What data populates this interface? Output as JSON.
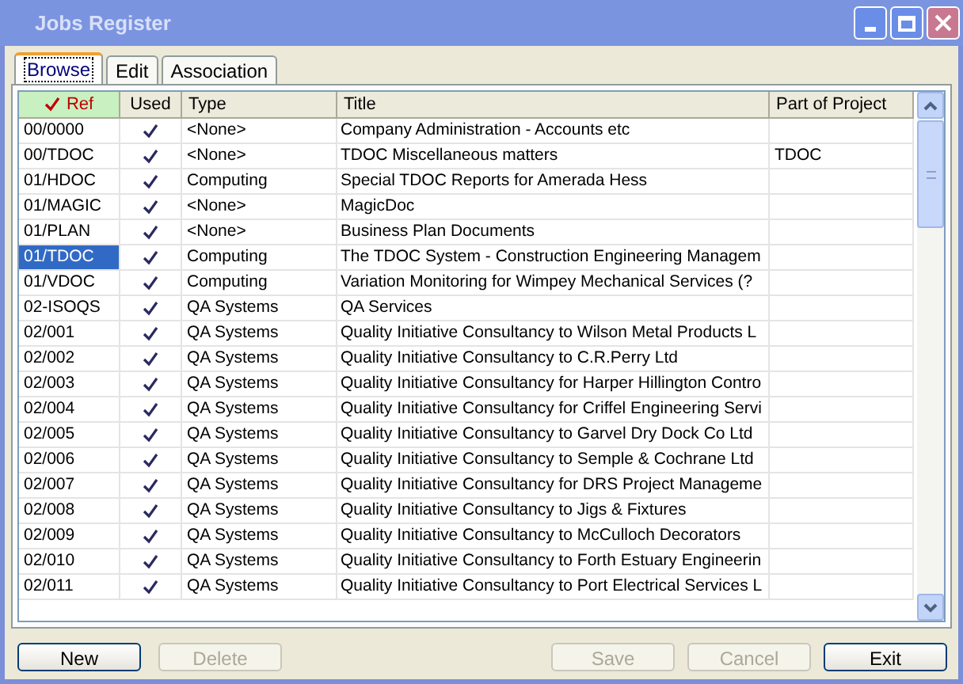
{
  "window": {
    "title": "Jobs Register",
    "active": false
  },
  "tabs": [
    {
      "label": "Browse",
      "selected": true
    },
    {
      "label": "Edit",
      "selected": false
    },
    {
      "label": "Association",
      "selected": false
    }
  ],
  "table": {
    "columns": [
      {
        "label": "Ref",
        "sorted": true
      },
      {
        "label": "Used",
        "sorted": false
      },
      {
        "label": "Type",
        "sorted": false
      },
      {
        "label": "Title",
        "sorted": false
      },
      {
        "label": "Part of Project",
        "sorted": false
      }
    ],
    "rows": [
      {
        "ref": "00/0000",
        "used": true,
        "type": "<None>",
        "title": "Company Administration - Accounts etc",
        "part_of_project": "",
        "selected": false
      },
      {
        "ref": "00/TDOC",
        "used": true,
        "type": "<None>",
        "title": "TDOC Miscellaneous matters",
        "part_of_project": "TDOC",
        "selected": false
      },
      {
        "ref": "01/HDOC",
        "used": true,
        "type": "Computing",
        "title": "Special TDOC Reports for Amerada Hess",
        "part_of_project": "",
        "selected": false
      },
      {
        "ref": "01/MAGIC",
        "used": true,
        "type": "<None>",
        "title": "MagicDoc",
        "part_of_project": "",
        "selected": false
      },
      {
        "ref": "01/PLAN",
        "used": true,
        "type": "<None>",
        "title": "Business Plan Documents",
        "part_of_project": "",
        "selected": false
      },
      {
        "ref": "01/TDOC",
        "used": true,
        "type": "Computing",
        "title": "The TDOC System - Construction Engineering Managem",
        "part_of_project": "",
        "selected": true
      },
      {
        "ref": "01/VDOC",
        "used": true,
        "type": "Computing",
        "title": "Variation Monitoring for Wimpey Mechanical Services (?",
        "part_of_project": "",
        "selected": false
      },
      {
        "ref": "02-ISOQS",
        "used": true,
        "type": "QA Systems",
        "title": "QA Services",
        "part_of_project": "",
        "selected": false
      },
      {
        "ref": "02/001",
        "used": true,
        "type": "QA Systems",
        "title": "Quality Initiative Consultancy to Wilson Metal Products L",
        "part_of_project": "",
        "selected": false
      },
      {
        "ref": "02/002",
        "used": true,
        "type": "QA Systems",
        "title": "Quality Initiative Consultancy to C.R.Perry Ltd",
        "part_of_project": "",
        "selected": false
      },
      {
        "ref": "02/003",
        "used": true,
        "type": "QA Systems",
        "title": "Quality Initiative Consultancy for Harper Hillington Contro",
        "part_of_project": "",
        "selected": false
      },
      {
        "ref": "02/004",
        "used": true,
        "type": "QA Systems",
        "title": "Quality Initiative Consultancy for Criffel Engineering Servi",
        "part_of_project": "",
        "selected": false
      },
      {
        "ref": "02/005",
        "used": true,
        "type": "QA Systems",
        "title": "Quality Initiative Consultancy to Garvel Dry Dock Co Ltd",
        "part_of_project": "",
        "selected": false
      },
      {
        "ref": "02/006",
        "used": true,
        "type": "QA Systems",
        "title": "Quality Initiative Consultancy to Semple & Cochrane Ltd",
        "part_of_project": "",
        "selected": false
      },
      {
        "ref": "02/007",
        "used": true,
        "type": "QA Systems",
        "title": "Quality Initiative Consultancy for DRS Project Manageme",
        "part_of_project": "",
        "selected": false
      },
      {
        "ref": "02/008",
        "used": true,
        "type": "QA Systems",
        "title": "Quality Initiative Consultancy to Jigs & Fixtures",
        "part_of_project": "",
        "selected": false
      },
      {
        "ref": "02/009",
        "used": true,
        "type": "QA Systems",
        "title": "Quality Initiative Consultancy to McCulloch Decorators",
        "part_of_project": "",
        "selected": false
      },
      {
        "ref": "02/010",
        "used": true,
        "type": "QA Systems",
        "title": "Quality Initiative Consultancy to Forth Estuary Engineerin",
        "part_of_project": "",
        "selected": false
      },
      {
        "ref": "02/011",
        "used": true,
        "type": "QA Systems",
        "title": "Quality Initiative Consultancy to Port Electrical Services L",
        "part_of_project": "",
        "selected": false
      }
    ]
  },
  "buttons": [
    {
      "label": "New",
      "disabled": false
    },
    {
      "label": "Delete",
      "disabled": true
    },
    {
      "label": "Save",
      "disabled": true
    },
    {
      "label": "Cancel",
      "disabled": true
    },
    {
      "label": "Exit",
      "disabled": false
    }
  ]
}
